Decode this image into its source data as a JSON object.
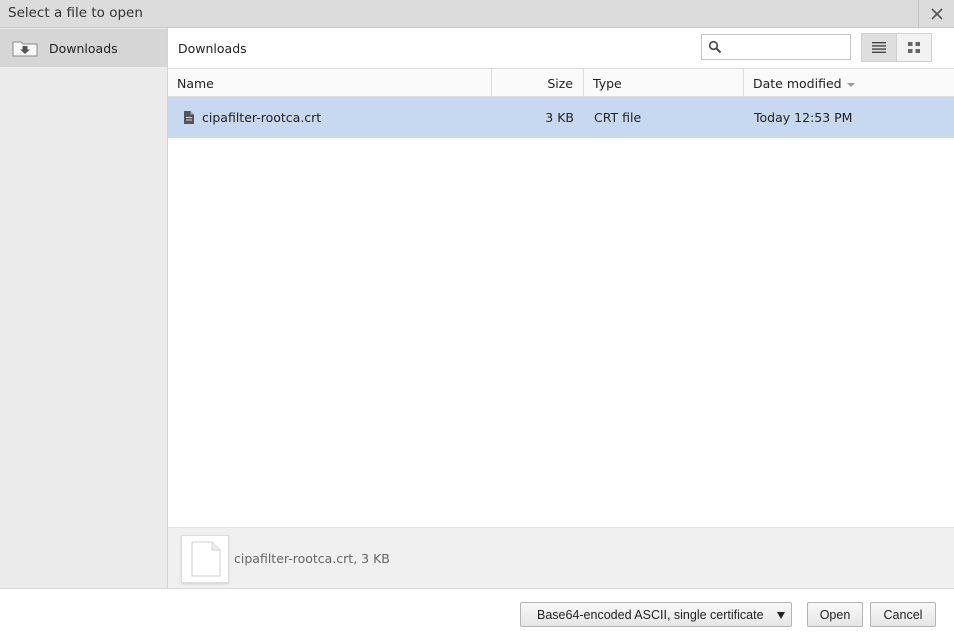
{
  "window": {
    "title": "Select a file to open",
    "close_icon": "close-icon"
  },
  "sidebar": {
    "items": [
      {
        "label": "Downloads",
        "icon": "downloads-folder-icon",
        "selected": true
      }
    ]
  },
  "toolbar": {
    "breadcrumb": "Downloads",
    "search": {
      "placeholder": "",
      "value": "",
      "icon": "search-icon"
    },
    "view_modes": [
      {
        "name": "list-view",
        "icon": "list-view-icon",
        "active": true
      },
      {
        "name": "thumbnail-view",
        "icon": "grid-view-icon",
        "active": false
      }
    ]
  },
  "file_list": {
    "columns": [
      "Name",
      "Size",
      "Type",
      "Date modified"
    ],
    "sort_column": "Date modified",
    "rows": [
      {
        "name": "cipafilter-rootca.crt",
        "size": "3 KB",
        "type": "CRT file",
        "date_modified": "Today 12:53 PM",
        "selected": true,
        "icon": "file-icon"
      }
    ]
  },
  "preview": {
    "text": "cipafilter-rootca.crt, 3 KB",
    "icon": "document-icon"
  },
  "footer": {
    "file_type_filter": "Base64-encoded ASCII, single certificate",
    "open_label": "Open",
    "cancel_label": "Cancel"
  },
  "colors": {
    "selection": "#c6d9f1",
    "sidebar_bg": "#ebebeb",
    "sidebar_selected": "#d6d6d6",
    "titlebar_bg": "#dcdcdc"
  }
}
